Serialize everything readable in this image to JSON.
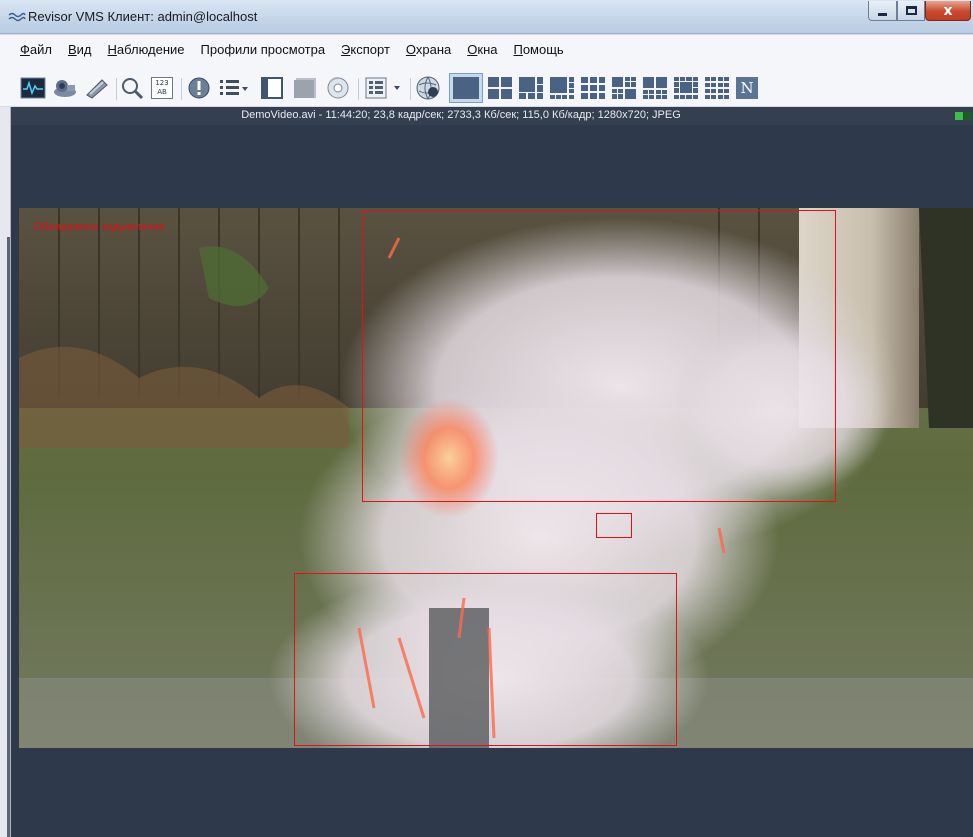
{
  "window": {
    "title": "Revisor VMS Клиент: admin@localhost",
    "icon": "app-wave-icon",
    "close_glyph": "x"
  },
  "menu": [
    {
      "label": "Файл",
      "ul": "Ф",
      "rest": "айл"
    },
    {
      "label": "Вид",
      "ul": "В",
      "rest": "ид"
    },
    {
      "label": "Наблюдение",
      "ul": "Н",
      "rest": "аблюдение"
    },
    {
      "label": "Профили просмотра",
      "ul": "",
      "rest": "Профили просмотра"
    },
    {
      "label": "Экспорт",
      "ul": "Э",
      "rest": "кспорт"
    },
    {
      "label": "Охрана",
      "ul": "О",
      "rest": "храна"
    },
    {
      "label": "Окна",
      "ul": "О",
      "rest": "кна"
    },
    {
      "label": "Помощь",
      "ul": "П",
      "rest": "омощь"
    }
  ],
  "toolbar": {
    "counter_badge": "123\nAB",
    "n_button": "N",
    "icons": [
      "monitor-icon",
      "camera-icon",
      "tool-icon",
      "search-icon",
      "counter-icon",
      "alert-icon",
      "list-icon",
      "panel-icon",
      "grid-gray-icon",
      "disc-icon",
      "layout-menu-icon",
      "globe-icon",
      "layout-1x1-icon",
      "layout-2x2-icon",
      "layout-1-plus-5-icon",
      "layout-1-plus-7-icon",
      "layout-3x3-icon",
      "layout-4x3-icon",
      "layout-2-plus-8-icon",
      "layout-1-plus-12-icon",
      "layout-4x4-icon",
      "layout-n-icon"
    ]
  },
  "video": {
    "info": "DemoVideo.avi - 11:44:20; 23,8 кадр/сек; 2733,3 Кб/сек; 115,0 Кб/кадр; 1280x720; JPEG",
    "alert": "Обнаружено задымление"
  },
  "colors": {
    "detection_box": "#e01313",
    "viewport_bg": "#2e3a4b",
    "status_ok": "#39c146"
  }
}
